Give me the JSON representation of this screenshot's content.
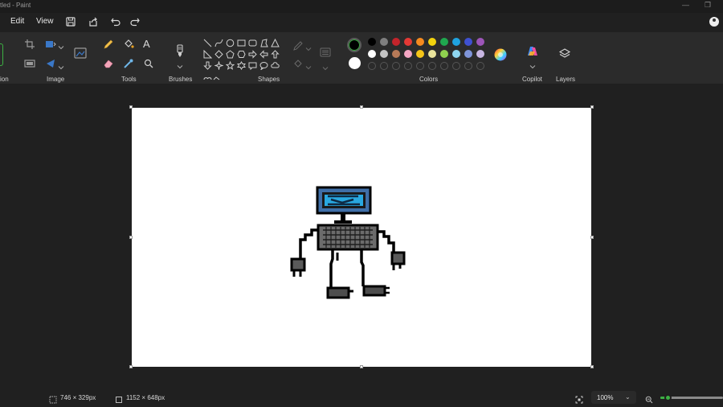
{
  "titlebar": {
    "title": "tled - Paint",
    "minimize": "—",
    "restore": "❐"
  },
  "menu": {
    "edit": "Edit",
    "view": "View"
  },
  "ribbon": {
    "groups": {
      "selection": "ion",
      "image": "Image",
      "tools": "Tools",
      "brushes": "Brushes",
      "shapes": "Shapes",
      "colors": "Colors",
      "copilot": "Copilot",
      "layers": "Layers"
    },
    "tools_text_glyph": "A",
    "colors": {
      "primary": "#000000",
      "secondary": "#ffffff",
      "row1": [
        "#000000",
        "#7f7f7f",
        "#c3242b",
        "#e53935",
        "#f58a1f",
        "#f2d20d",
        "#1fa84f",
        "#1fa3e0",
        "#3f51d1",
        "#9c55b8"
      ],
      "row2": [
        "#ffffff",
        "#c3c3c3",
        "#b77a58",
        "#f4a6c3",
        "#f5c518",
        "#e9e39b",
        "#8fd14f",
        "#8ed6f0",
        "#7f95d9",
        "#c8b6e2"
      ]
    }
  },
  "canvas": {
    "background": "#ffffff"
  },
  "status": {
    "selection_size": "746 × 329px",
    "canvas_size": "1152 × 648px",
    "zoom": "100%",
    "zoom_fraction": 0.12
  }
}
